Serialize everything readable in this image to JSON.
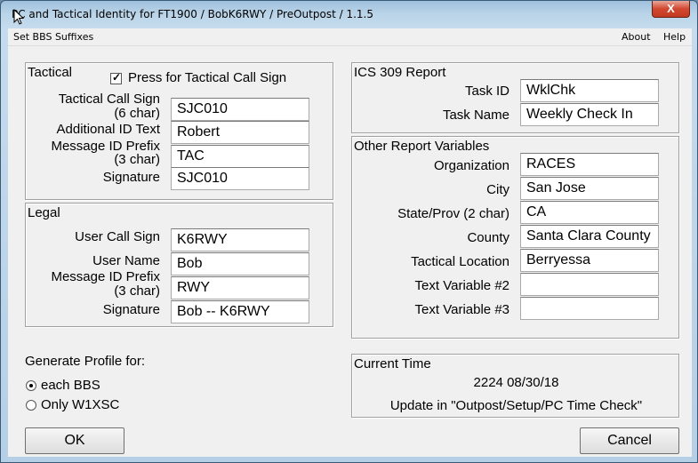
{
  "window": {
    "title": "PC and Tactical Identity for FT1900 / BobK6RWY / PreOutpost / 1.1.5",
    "close_glyph": "X"
  },
  "menu": {
    "left": "Set BBS Suffixes",
    "about": "About",
    "help": "Help"
  },
  "tactical": {
    "title": "Tactical",
    "checkbox_label": "Press for Tactical Call Sign",
    "checked": true,
    "rows": [
      {
        "label": "Tactical Call Sign\n(6 char)",
        "value": "SJC010"
      },
      {
        "label": "Additional ID Text",
        "value": "Robert"
      },
      {
        "label": "Message ID Prefix\n(3 char)",
        "value": "TAC"
      },
      {
        "label": "Signature",
        "value": "SJC010"
      }
    ]
  },
  "legal": {
    "title": "Legal",
    "rows": [
      {
        "label": "User Call Sign",
        "value": "K6RWY"
      },
      {
        "label": "User Name",
        "value": "Bob"
      },
      {
        "label": "Message ID Prefix\n(3 char)",
        "value": "RWY"
      },
      {
        "label": "Signature",
        "value": "Bob -- K6RWY"
      }
    ]
  },
  "profile": {
    "label": "Generate Profile for:",
    "options": [
      {
        "label": "each BBS",
        "selected": true
      },
      {
        "label": "Only W1XSC",
        "selected": false
      }
    ]
  },
  "ics309": {
    "title": "ICS 309 Report",
    "rows": [
      {
        "label": "Task ID",
        "value": "WklChk"
      },
      {
        "label": "Task Name",
        "value": "Weekly Check In"
      }
    ]
  },
  "other": {
    "title": "Other Report Variables",
    "rows": [
      {
        "label": "Organization",
        "value": "RACES"
      },
      {
        "label": "City",
        "value": "San Jose"
      },
      {
        "label": "State/Prov (2 char)",
        "value": "CA"
      },
      {
        "label": "County",
        "value": "Santa Clara County"
      },
      {
        "label": "Tactical Location",
        "value": "Berryessa"
      },
      {
        "label": "Text Variable #2",
        "value": ""
      },
      {
        "label": "Text Variable #3",
        "value": ""
      }
    ]
  },
  "time": {
    "title": "Current Time",
    "value": "2224 08/30/18",
    "note": "Update in \"Outpost/Setup/PC Time Check\""
  },
  "buttons": {
    "ok": "OK",
    "cancel": "Cancel"
  }
}
